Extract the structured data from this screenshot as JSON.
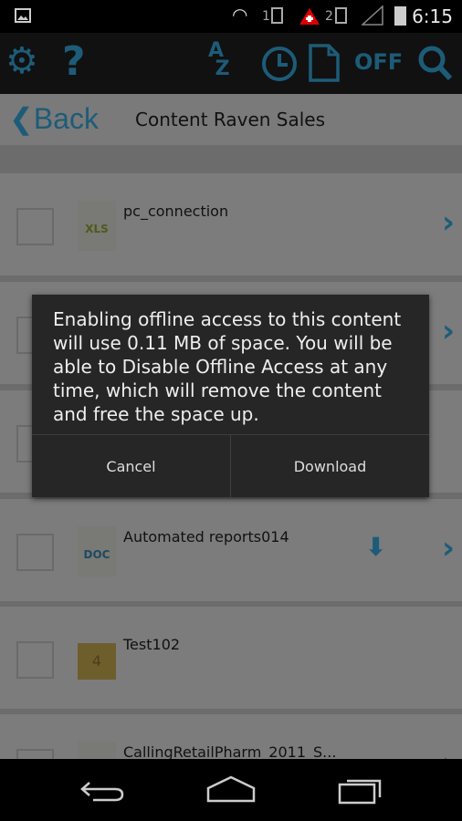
{
  "status": {
    "time": "6:15",
    "icons": [
      "image-icon",
      "wifi-icon",
      "sim1-icon",
      "alert-icon",
      "sim2-icon",
      "signal-icon",
      "battery-icon"
    ],
    "sim1": "1",
    "sim2": "2"
  },
  "toolbar": {
    "off_label": "OFF",
    "icons": [
      "gear-icon",
      "help-icon",
      "sort-az-icon",
      "clock-icon",
      "document-icon",
      "offline-toggle",
      "search-icon"
    ],
    "accent": "#1d5c78"
  },
  "nav": {
    "back_label": "Back",
    "title": "Content Raven Sales"
  },
  "list": {
    "items": [
      {
        "name": "pc_connection",
        "type": "XLS",
        "kind": "file"
      },
      {
        "name": "",
        "type": "",
        "kind": "file"
      },
      {
        "name": "",
        "type": "",
        "kind": "file"
      },
      {
        "name": "Automated reports014",
        "type": "DOC",
        "kind": "file",
        "download": true
      },
      {
        "name": "Test102",
        "type": "4",
        "kind": "folder"
      },
      {
        "name": "CallingRetailPharm_2011_S...",
        "type": "",
        "kind": "file"
      }
    ]
  },
  "dialog": {
    "message": "Enabling offline access to this content will use 0.11 MB of space. You will be able to Disable Offline Access at any time, which will remove the content and free the space up.",
    "cancel": "Cancel",
    "download": "Download"
  }
}
